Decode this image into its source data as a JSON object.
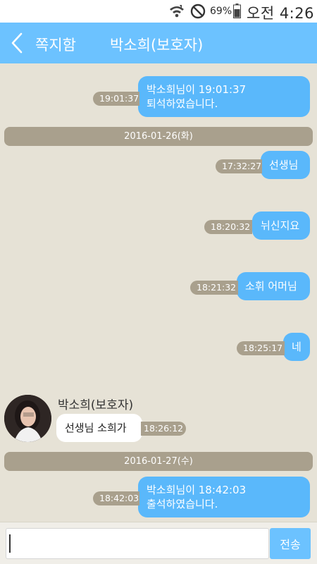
{
  "status_bar": {
    "battery_pct": "69%",
    "clock": "오전 4:26"
  },
  "header": {
    "back_label": "쪽지함",
    "title": "박소희(보호자)"
  },
  "messages": [
    {
      "text": "박소희님이 19:01:37\n퇴석하였습니다.",
      "time": "19:01:37"
    },
    {
      "date": "2016-01-26(화)"
    },
    {
      "text": "선생님",
      "time": "17:32:27"
    },
    {
      "text": "뉘신지요",
      "time": "18:20:32"
    },
    {
      "text": "소휘 어머님",
      "time": "18:21:32"
    },
    {
      "text": "네",
      "time": "18:25:17"
    },
    {
      "sender": "박소희(보호자)",
      "text": "선생님 소희가",
      "time": "18:26:12"
    },
    {
      "date": "2016-01-27(수)"
    },
    {
      "text": "박소희님이 18:42:03\n출석하였습니다.",
      "time": "18:42:03"
    }
  ],
  "composer": {
    "value": "",
    "send_label": "전송"
  },
  "colors": {
    "accent": "#6cc2ff",
    "outgoing_bubble": "#5ab8fb",
    "timestamp_bg": "#a9a08d",
    "chat_bg": "#e6e2d6"
  }
}
